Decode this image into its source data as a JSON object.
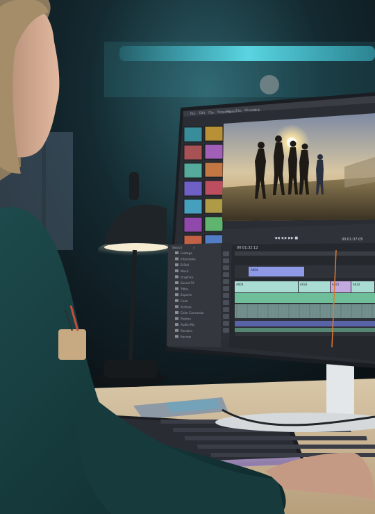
{
  "photo": {
    "subject": "person",
    "setting": "desk",
    "device": "monitor"
  },
  "editor": {
    "title": "",
    "menu": [
      "File",
      "Edit",
      "Clip",
      "Sequence",
      "Marker",
      "Title",
      "Window",
      "Help"
    ],
    "preview_timecode": "00:01:37:05",
    "timeline_timecode": "00:01:32:12",
    "search_placeholder": "Search",
    "folders": [
      "Footage",
      "Interviews",
      "B-Roll",
      "Music",
      "Graphics",
      "Sound FX",
      "Titles",
      "Exports",
      "Color",
      "Archive",
      "Color Correction",
      "Proxies",
      "Audio Mix",
      "Renders",
      "Review"
    ],
    "tracks": [
      {
        "label": "V2",
        "clips": [
          "A004"
        ]
      },
      {
        "label": "V1",
        "clips": [
          "A004",
          "A033",
          "A025",
          "A032"
        ]
      },
      {
        "label": "A1",
        "clips": []
      },
      {
        "label": "A2",
        "clips": []
      }
    ],
    "accent": "#6a79d6",
    "clip_colors": [
      "#8e9ae6",
      "#a9ddd3",
      "#6fbe9a",
      "#c2a9df"
    ],
    "playhead_color": "#e07a2f"
  }
}
